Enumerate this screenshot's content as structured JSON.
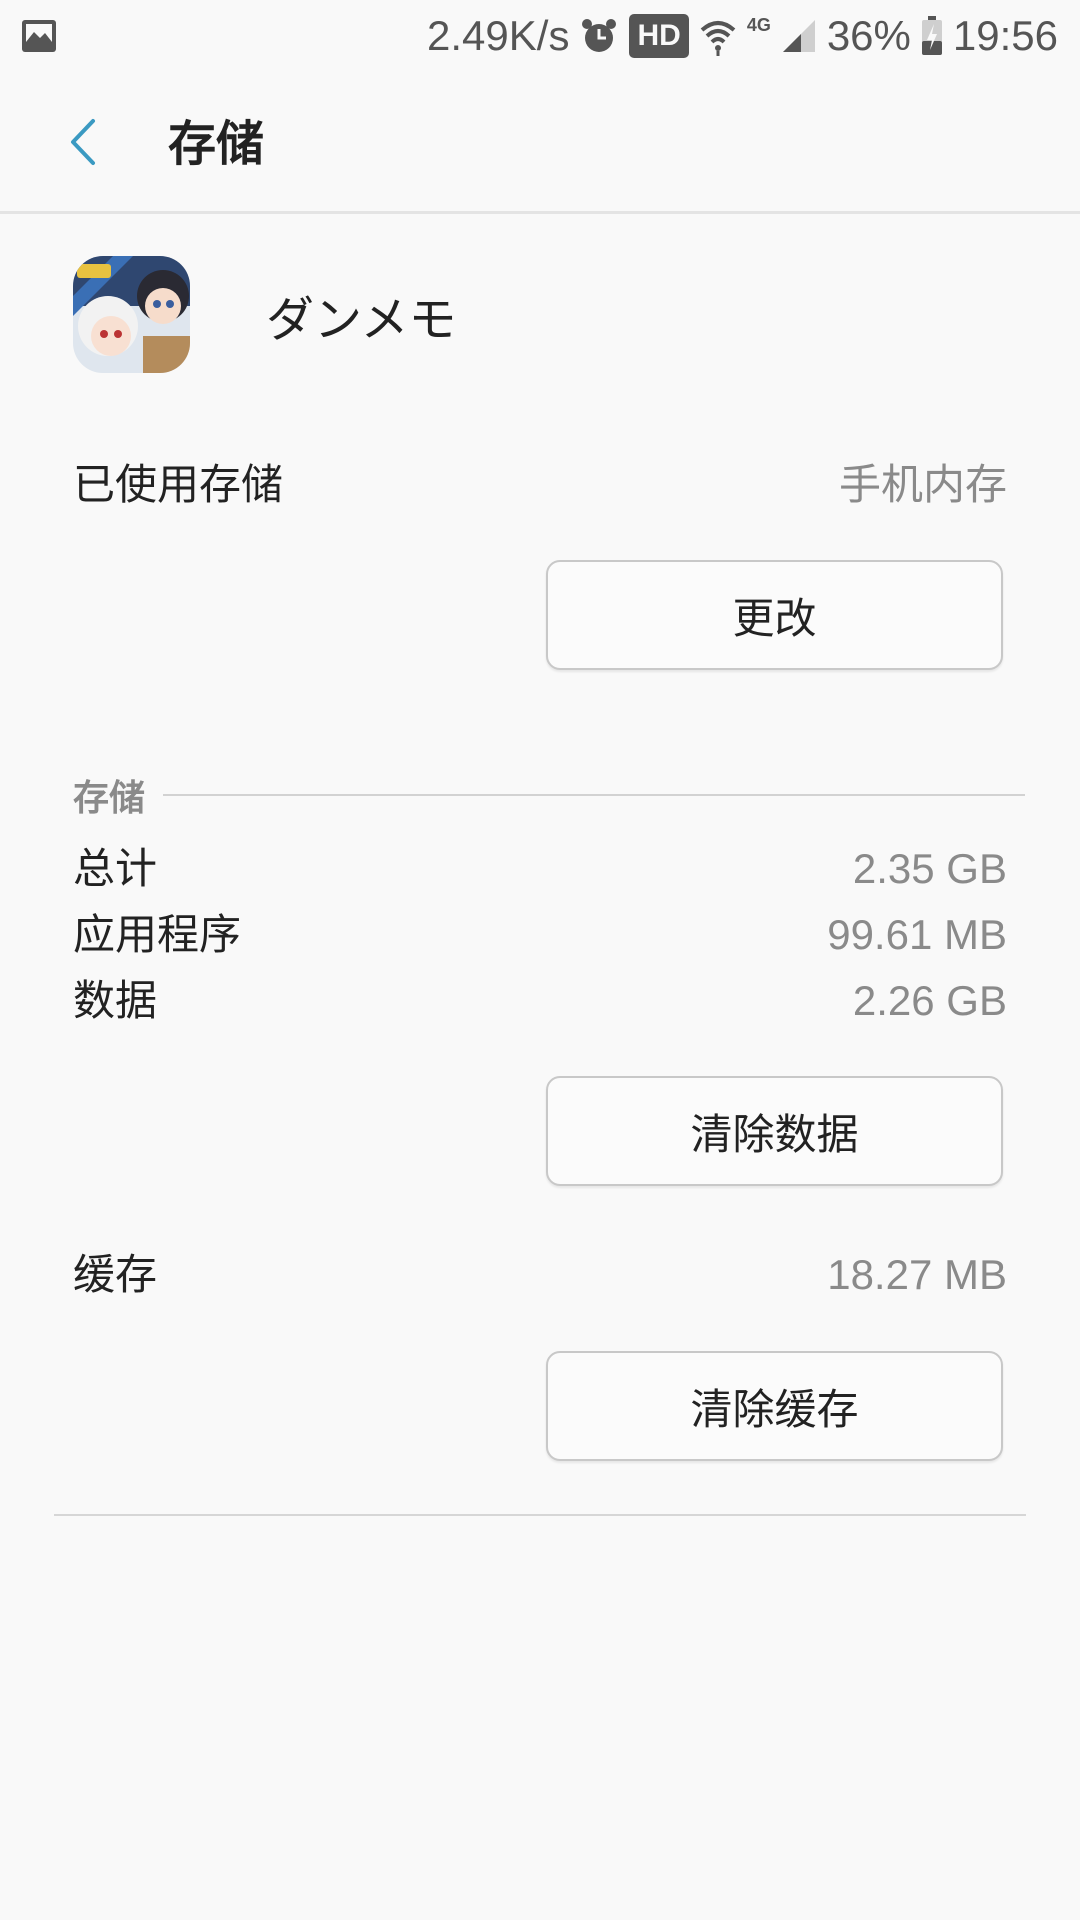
{
  "status_bar": {
    "net_speed": "2.49K/s",
    "hd": "HD",
    "network_type": "4G",
    "battery": "36%",
    "time": "19:56",
    "icons": [
      "image-icon",
      "alarm-icon",
      "wifi-icon",
      "signal-icon",
      "battery-charging-icon"
    ]
  },
  "app_bar": {
    "title": "存储",
    "back_icon": "chevron-left-icon",
    "accent": "#3b9ac2"
  },
  "app": {
    "name": "ダンメモ",
    "icon": "app-icon"
  },
  "used_storage": {
    "label": "已使用存储",
    "value": "手机内存",
    "change_button": "更改"
  },
  "storage": {
    "section_title": "存储",
    "rows": [
      {
        "label": "总计",
        "value": "2.35 GB"
      },
      {
        "label": "应用程序",
        "value": "99.61 MB"
      },
      {
        "label": "数据",
        "value": "2.26 GB"
      }
    ],
    "clear_data_button": "清除数据"
  },
  "cache": {
    "label": "缓存",
    "value": "18.27 MB",
    "clear_cache_button": "清除缓存"
  }
}
